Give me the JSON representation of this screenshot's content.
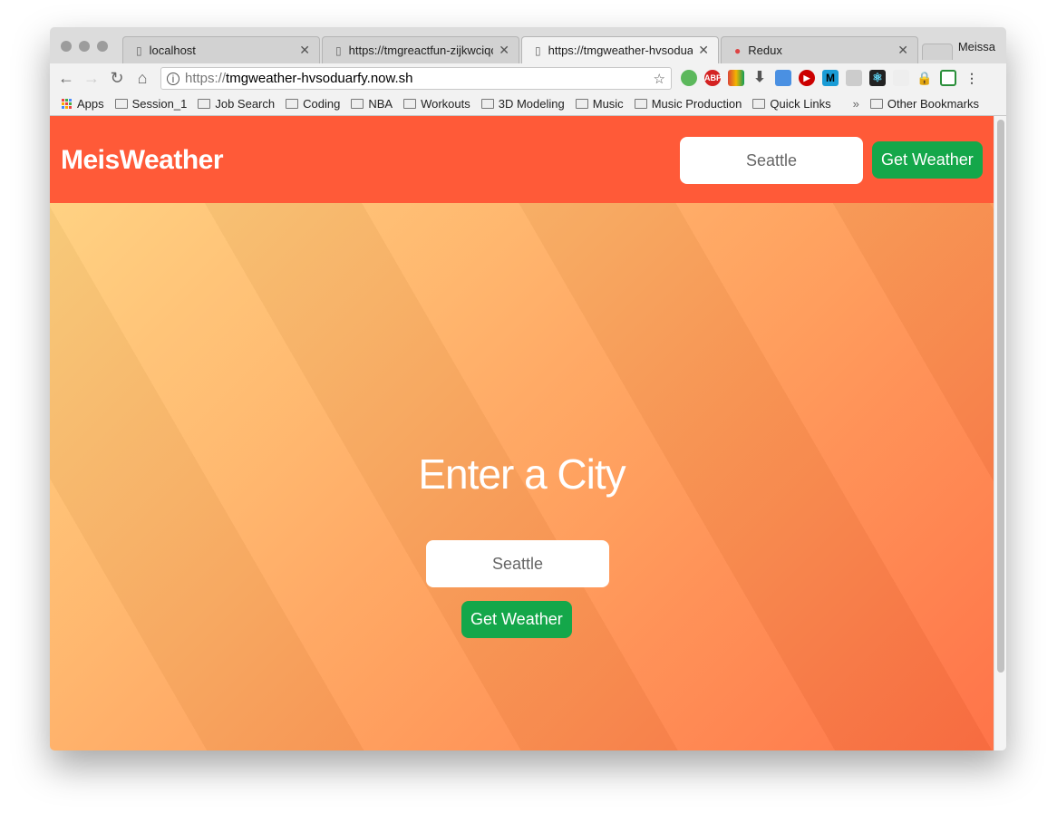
{
  "browser": {
    "tabs": [
      {
        "title": "localhost",
        "active": false
      },
      {
        "title": "https://tmgreactfun-zijkwciqc",
        "active": false
      },
      {
        "title": "https://tmgweather-hvsoduar",
        "active": true
      },
      {
        "title": "Redux",
        "active": false
      }
    ],
    "user": "Meissa",
    "url_scheme": "https://",
    "url_rest": "tmgweather-hvsoduarfy.now.sh",
    "bookmarks": [
      "Apps",
      "Session_1",
      "Job Search",
      "Coding",
      "NBA",
      "Workouts",
      "3D Modeling",
      "Music",
      "Music Production",
      "Quick Links"
    ],
    "other_bookmarks": "Other Bookmarks",
    "extensions": [
      "adguard",
      "ABP",
      "chrome-download",
      "download",
      "eyedropper",
      "youtube",
      "M",
      "wrench",
      "react",
      "blank",
      "lock",
      "screenshot"
    ]
  },
  "app": {
    "logo": "MeisWeather",
    "header_city": "Seattle",
    "header_button": "Get Weather",
    "title": "Enter a City",
    "city": "Seattle",
    "button": "Get Weather",
    "colors": {
      "header": "#ff5a38",
      "button": "#14a74a"
    }
  }
}
